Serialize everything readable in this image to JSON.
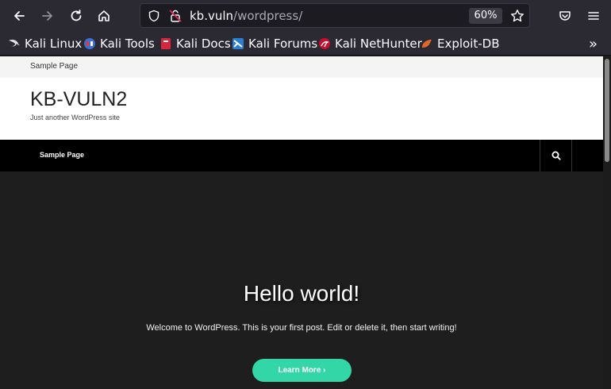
{
  "browser": {
    "url_host": "kb.vuln",
    "url_path": "/wordpress/",
    "zoom": "60%",
    "bookmarks": [
      {
        "label": "Kali Linux",
        "icon": "kali-dragon-icon"
      },
      {
        "label": "Kali Tools",
        "icon": "kali-tools-icon"
      },
      {
        "label": "Kali Docs",
        "icon": "kali-docs-icon"
      },
      {
        "label": "Kali Forums",
        "icon": "kali-forums-icon"
      },
      {
        "label": "Kali NetHunter",
        "icon": "kali-nethunter-icon"
      },
      {
        "label": "Exploit-DB",
        "icon": "exploit-db-icon"
      }
    ],
    "overflow_label": "»"
  },
  "site": {
    "top_link": "Sample Page",
    "title": "KB-VULN2",
    "tagline": "Just another WordPress site",
    "nav_item": "Sample Page"
  },
  "hero": {
    "title": "Hello world!",
    "text": "Welcome to WordPress. This is your first post. Edit or delete it, then start writing!",
    "button_label": "Learn More ›"
  },
  "colors": {
    "accent": "#33d6a6",
    "toolbar": "#2b2a33",
    "hero_bg": "#1e1e1e"
  }
}
